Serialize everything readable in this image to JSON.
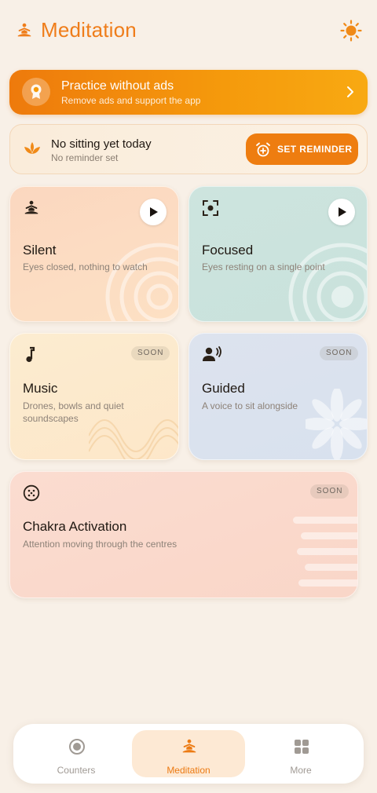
{
  "header": {
    "title": "Meditation",
    "logo_icon": "meditation-pose-icon",
    "theme_icon": "sun-icon"
  },
  "promo": {
    "title": "Practice without ads",
    "subtitle": "Remove ads and support the app",
    "icon": "ribbon-badge-icon"
  },
  "reminder": {
    "title": "No sitting yet today",
    "subtitle": "No reminder set",
    "button_label": "SET REMINDER",
    "icon": "lotus-icon"
  },
  "cards": {
    "silent": {
      "title": "Silent",
      "subtitle": "Eyes closed, nothing to watch",
      "icon": "meditation-pose-icon"
    },
    "focused": {
      "title": "Focused",
      "subtitle": "Eyes resting on a single point",
      "icon": "focus-frame-icon"
    },
    "music": {
      "title": "Music",
      "subtitle": "Drones, bowls and quiet soundscapes",
      "badge": "SOON",
      "icon": "music-note-icon"
    },
    "guided": {
      "title": "Guided",
      "subtitle": "A voice to sit alongside",
      "badge": "SOON",
      "icon": "voice-person-icon"
    },
    "chakra": {
      "title": "Chakra Activation",
      "subtitle": "Attention moving through the centres",
      "badge": "SOON",
      "icon": "chakra-dots-icon"
    }
  },
  "nav": {
    "items": [
      {
        "label": "Counters",
        "icon": "radio-circle-icon"
      },
      {
        "label": "Meditation",
        "icon": "meditation-pose-icon",
        "active": true
      },
      {
        "label": "More",
        "icon": "grid-icon"
      }
    ]
  },
  "colors": {
    "accent": "#ee7d10",
    "background": "#f8f0e7"
  }
}
